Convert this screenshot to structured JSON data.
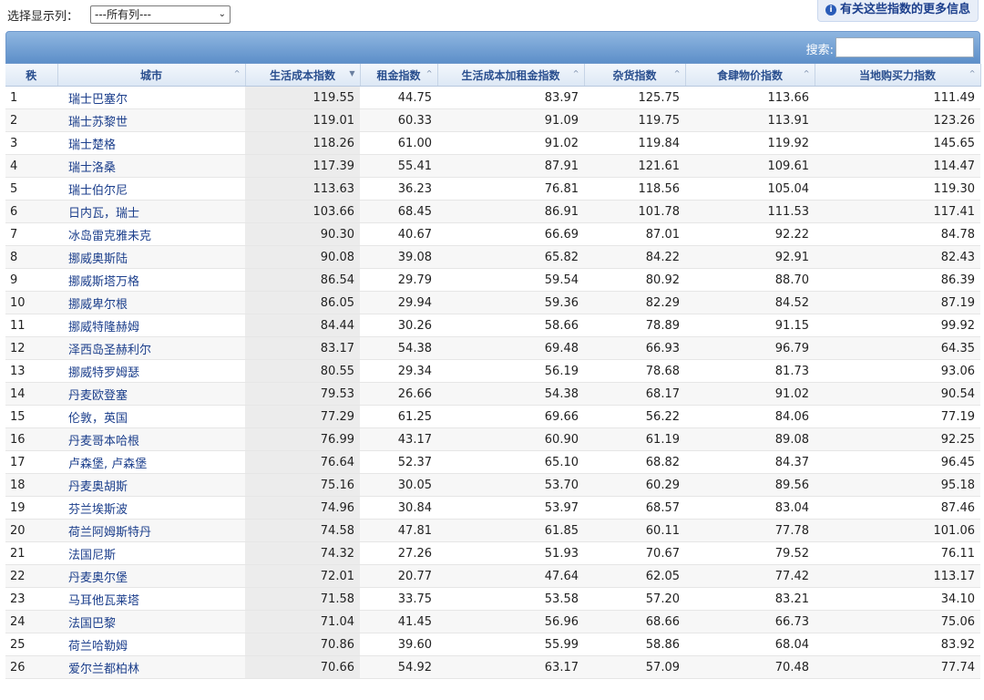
{
  "controls": {
    "select_label": "选择显示列：",
    "select_value": "---所有列---",
    "info_link": "有关这些指数的更多信息",
    "search_label": "搜索:"
  },
  "table": {
    "headers": [
      "秩",
      "城市",
      "生活成本指数",
      "租金指数",
      "生活成本加租金指数",
      "杂货指数",
      "食肆物价指数",
      "当地购买力指数"
    ],
    "sorted_column": "生活成本指数",
    "rows": [
      {
        "rank": "1",
        "city": "瑞士巴塞尔",
        "col": "119.55",
        "rent": "44.75",
        "colrent": "83.97",
        "groc": "125.75",
        "rest": "113.66",
        "ppi": "111.49"
      },
      {
        "rank": "2",
        "city": "瑞士苏黎世",
        "col": "119.01",
        "rent": "60.33",
        "colrent": "91.09",
        "groc": "119.75",
        "rest": "113.91",
        "ppi": "123.26"
      },
      {
        "rank": "3",
        "city": "瑞士楚格",
        "col": "118.26",
        "rent": "61.00",
        "colrent": "91.02",
        "groc": "119.84",
        "rest": "119.92",
        "ppi": "145.65"
      },
      {
        "rank": "4",
        "city": "瑞士洛桑",
        "col": "117.39",
        "rent": "55.41",
        "colrent": "87.91",
        "groc": "121.61",
        "rest": "109.61",
        "ppi": "114.47"
      },
      {
        "rank": "5",
        "city": "瑞士伯尔尼",
        "col": "113.63",
        "rent": "36.23",
        "colrent": "76.81",
        "groc": "118.56",
        "rest": "105.04",
        "ppi": "119.30"
      },
      {
        "rank": "6",
        "city": "日内瓦，瑞士",
        "col": "103.66",
        "rent": "68.45",
        "colrent": "86.91",
        "groc": "101.78",
        "rest": "111.53",
        "ppi": "117.41"
      },
      {
        "rank": "7",
        "city": "冰岛雷克雅未克",
        "col": "90.30",
        "rent": "40.67",
        "colrent": "66.69",
        "groc": "87.01",
        "rest": "92.22",
        "ppi": "84.78"
      },
      {
        "rank": "8",
        "city": "挪威奥斯陆",
        "col": "90.08",
        "rent": "39.08",
        "colrent": "65.82",
        "groc": "84.22",
        "rest": "92.91",
        "ppi": "82.43"
      },
      {
        "rank": "9",
        "city": "挪威斯塔万格",
        "col": "86.54",
        "rent": "29.79",
        "colrent": "59.54",
        "groc": "80.92",
        "rest": "88.70",
        "ppi": "86.39"
      },
      {
        "rank": "10",
        "city": "挪威卑尔根",
        "col": "86.05",
        "rent": "29.94",
        "colrent": "59.36",
        "groc": "82.29",
        "rest": "84.52",
        "ppi": "87.19"
      },
      {
        "rank": "11",
        "city": "挪威特隆赫姆",
        "col": "84.44",
        "rent": "30.26",
        "colrent": "58.66",
        "groc": "78.89",
        "rest": "91.15",
        "ppi": "99.92"
      },
      {
        "rank": "12",
        "city": "泽西岛圣赫利尔",
        "col": "83.17",
        "rent": "54.38",
        "colrent": "69.48",
        "groc": "66.93",
        "rest": "96.79",
        "ppi": "64.35"
      },
      {
        "rank": "13",
        "city": "挪威特罗姆瑟",
        "col": "80.55",
        "rent": "29.34",
        "colrent": "56.19",
        "groc": "78.68",
        "rest": "81.73",
        "ppi": "93.06"
      },
      {
        "rank": "14",
        "city": "丹麦欧登塞",
        "col": "79.53",
        "rent": "26.66",
        "colrent": "54.38",
        "groc": "68.17",
        "rest": "91.02",
        "ppi": "90.54"
      },
      {
        "rank": "15",
        "city": "伦敦，英国",
        "col": "77.29",
        "rent": "61.25",
        "colrent": "69.66",
        "groc": "56.22",
        "rest": "84.06",
        "ppi": "77.19"
      },
      {
        "rank": "16",
        "city": "丹麦哥本哈根",
        "col": "76.99",
        "rent": "43.17",
        "colrent": "60.90",
        "groc": "61.19",
        "rest": "89.08",
        "ppi": "92.25"
      },
      {
        "rank": "17",
        "city": "卢森堡, 卢森堡",
        "col": "76.64",
        "rent": "52.37",
        "colrent": "65.10",
        "groc": "68.82",
        "rest": "84.37",
        "ppi": "96.45"
      },
      {
        "rank": "18",
        "city": "丹麦奥胡斯",
        "col": "75.16",
        "rent": "30.05",
        "colrent": "53.70",
        "groc": "60.29",
        "rest": "89.56",
        "ppi": "95.18"
      },
      {
        "rank": "19",
        "city": "芬兰埃斯波",
        "col": "74.96",
        "rent": "30.84",
        "colrent": "53.97",
        "groc": "68.57",
        "rest": "83.04",
        "ppi": "87.46"
      },
      {
        "rank": "20",
        "city": "荷兰阿姆斯特丹",
        "col": "74.58",
        "rent": "47.81",
        "colrent": "61.85",
        "groc": "60.11",
        "rest": "77.78",
        "ppi": "101.06"
      },
      {
        "rank": "21",
        "city": "法国尼斯",
        "col": "74.32",
        "rent": "27.26",
        "colrent": "51.93",
        "groc": "70.67",
        "rest": "79.52",
        "ppi": "76.11"
      },
      {
        "rank": "22",
        "city": "丹麦奥尔堡",
        "col": "72.01",
        "rent": "20.77",
        "colrent": "47.64",
        "groc": "62.05",
        "rest": "77.42",
        "ppi": "113.17"
      },
      {
        "rank": "23",
        "city": "马耳他瓦莱塔",
        "col": "71.58",
        "rent": "33.75",
        "colrent": "53.58",
        "groc": "57.20",
        "rest": "83.21",
        "ppi": "34.10"
      },
      {
        "rank": "24",
        "city": "法国巴黎",
        "col": "71.04",
        "rent": "41.45",
        "colrent": "56.96",
        "groc": "68.66",
        "rest": "66.73",
        "ppi": "75.06"
      },
      {
        "rank": "25",
        "city": "荷兰哈勒姆",
        "col": "70.86",
        "rent": "39.60",
        "colrent": "55.99",
        "groc": "58.86",
        "rest": "68.04",
        "ppi": "83.92"
      },
      {
        "rank": "26",
        "city": "爱尔兰都柏林",
        "col": "70.66",
        "rent": "54.92",
        "colrent": "63.17",
        "groc": "57.09",
        "rest": "70.48",
        "ppi": "77.74"
      }
    ]
  }
}
